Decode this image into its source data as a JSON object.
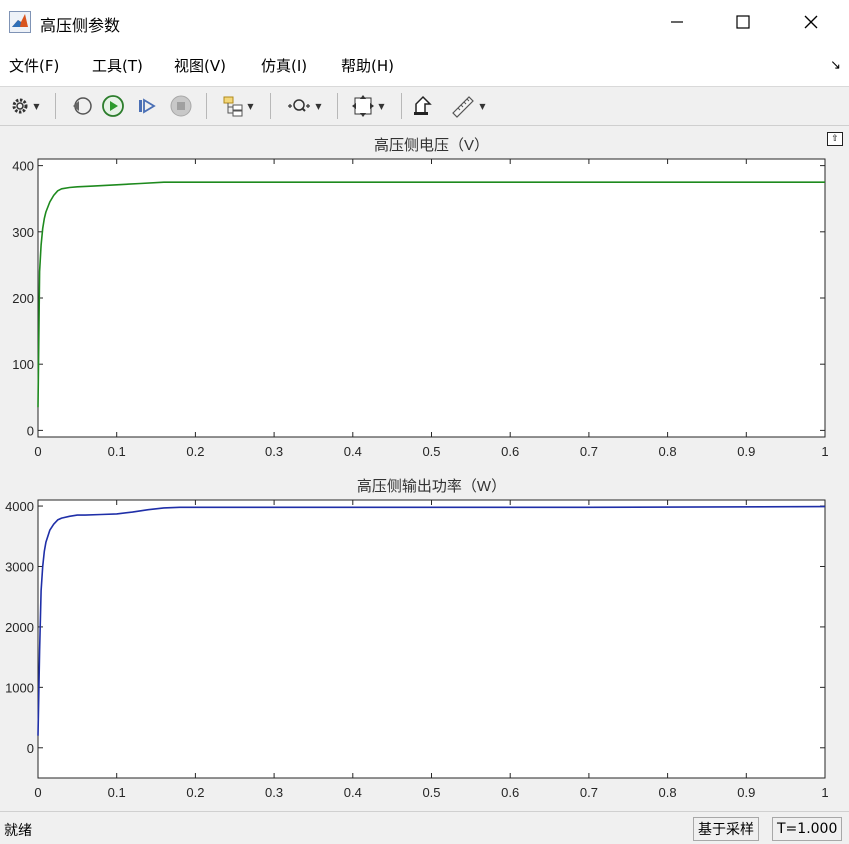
{
  "window": {
    "title": "高压侧参数"
  },
  "menu": {
    "items": [
      "文件(F)",
      "工具(T)",
      "视图(V)",
      "仿真(I)",
      "帮助(H)"
    ]
  },
  "status": {
    "left": "就绪",
    "mode": "基于采样",
    "time": "T=1.000"
  },
  "colors": {
    "voltage_line": "#1e8a1e",
    "power_line": "#1f2fa8"
  },
  "chart_data": [
    {
      "type": "line",
      "title": "高压侧电压（V）",
      "xlim": [
        0,
        1
      ],
      "ylim": [
        -10,
        410
      ],
      "xticks": [
        "0",
        "0.1",
        "0.2",
        "0.3",
        "0.4",
        "0.5",
        "0.6",
        "0.7",
        "0.8",
        "0.9",
        "1"
      ],
      "yticks": [
        "0",
        "100",
        "200",
        "300",
        "400"
      ],
      "series": [
        {
          "x": [
            0,
            0.002,
            0.004,
            0.006,
            0.008,
            0.01,
            0.015,
            0.02,
            0.025,
            0.03,
            0.04,
            0.05,
            0.07,
            0.1,
            0.13,
            0.16,
            0.2,
            0.3,
            0.5,
            0.7,
            1.0
          ],
          "y": [
            35,
            240,
            280,
            305,
            320,
            330,
            345,
            355,
            362,
            365,
            367,
            368,
            369,
            371,
            373,
            375,
            375,
            375,
            375,
            375,
            375
          ]
        }
      ]
    },
    {
      "type": "line",
      "title": "高压侧输出功率（W）",
      "xlim": [
        0,
        1
      ],
      "ylim": [
        -500,
        4100
      ],
      "xticks": [
        "0",
        "0.1",
        "0.2",
        "0.3",
        "0.4",
        "0.5",
        "0.6",
        "0.7",
        "0.8",
        "0.9",
        "1"
      ],
      "yticks": [
        "0",
        "1000",
        "2000",
        "3000",
        "4000"
      ],
      "series": [
        {
          "x": [
            0,
            0.002,
            0.004,
            0.006,
            0.008,
            0.01,
            0.015,
            0.02,
            0.025,
            0.03,
            0.04,
            0.05,
            0.06,
            0.08,
            0.1,
            0.12,
            0.14,
            0.16,
            0.18,
            0.2,
            0.3,
            0.5,
            0.7,
            1.0
          ],
          "y": [
            200,
            1600,
            2600,
            3000,
            3250,
            3400,
            3600,
            3700,
            3770,
            3800,
            3830,
            3850,
            3850,
            3860,
            3870,
            3900,
            3940,
            3970,
            3980,
            3980,
            3980,
            3980,
            3980,
            3990
          ]
        }
      ]
    }
  ]
}
